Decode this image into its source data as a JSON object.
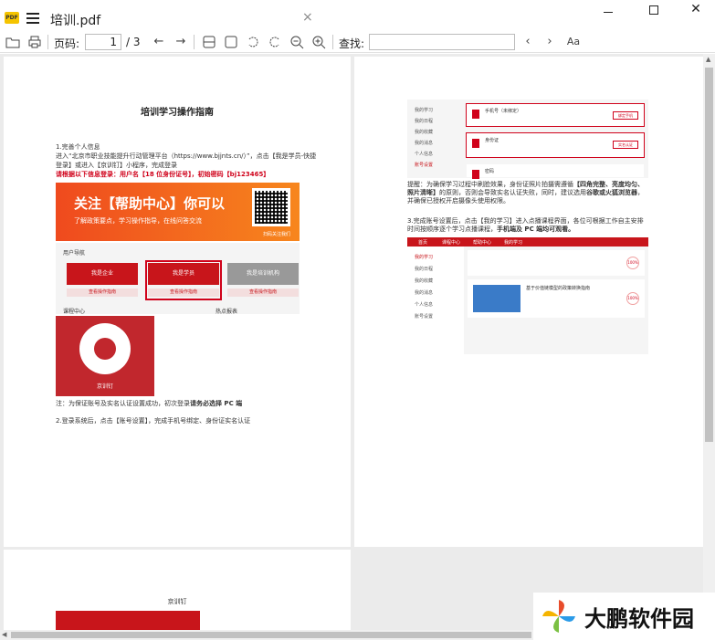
{
  "window": {
    "app_logo_text": "PDF",
    "tab_title": "培训.pdf",
    "close_tab": "×",
    "maximize": "",
    "close": "✕"
  },
  "toolbar": {
    "page_label": "页码:",
    "page_current": "1",
    "page_total": "/ 3",
    "search_label": "查找:",
    "search_value": ""
  },
  "page1": {
    "title": "培训学习操作指南",
    "step1_heading": "1.完善个人信息",
    "step1_line1": "进入“北京市职业技能提升行动管理平台（https://www.bjjnts.cn/）”，点击【我是学员-快捷",
    "step1_line2": "登录】或进入【京训钉】小程序，完成登录",
    "step1_red": "请根据以下信息登录：用户名【18 位身份证号】，初始密码【bj123465】",
    "banner_title": "关注【帮助中心】你可以",
    "banner_sub": "了解政策要点，学习操作指导，在线问答交流",
    "banner_qr_caption": "扫码关注我们",
    "entry_label": "用户导航",
    "entry_cards": [
      "我是企业",
      "我是学员",
      "我是培训机构"
    ],
    "entry_buttons": [
      "查看操作指南",
      "查看操作指南",
      "查看操作指南"
    ],
    "entry_bottom_left": "课程中心",
    "entry_bottom_right": "热点报表",
    "mini_qr_caption": "京训钉",
    "note_prefix": "注：为保证账号及实名认证设置成功，初次登录",
    "note_bold": "请务必选择 PC 端",
    "step2": "2.登录系统后，点击【账号设置】，完成手机号绑定、身份证实名认证"
  },
  "page2": {
    "sidebar_items": [
      "我的学习",
      "我的日程",
      "我的收藏",
      "我的消息",
      "个人信息",
      "账号设置"
    ],
    "box1_title": "手机号（未绑定）",
    "box1_button": "绑定手机",
    "box2_title": "身份证",
    "box2_button": "实名认证",
    "box3_title": "密码",
    "tip_prefix": "提醒：为确保学习过程中刷脸效果，身份证照片拍摄需遵循",
    "tip_bold1": "【四角完整、亮度均匀、照片清晰】",
    "tip_mid": "的原则，否则会导致实名认证失败，同时，建议选用",
    "tip_bold2": "谷歌或火狐浏览器",
    "tip_end": "，并确保已授权开启摄像头使用权限。",
    "step3_prefix": "3.完成账号设置后，点击【我的学习】进入点播课程界面，各位可根据工作自主安排时间按顺序逐个学习点播课程，",
    "step3_bold": "手机端及 PC 端均可观看。",
    "nav_items": [
      "首页",
      "课程中心",
      "帮助中心",
      "我的学习"
    ],
    "course_percent": [
      "100%",
      "100%"
    ],
    "course_title": "基于价值链模型的政策转换指南"
  },
  "page3": {
    "header": "京训钉"
  },
  "watermark": {
    "text": "大鹏软件园"
  }
}
